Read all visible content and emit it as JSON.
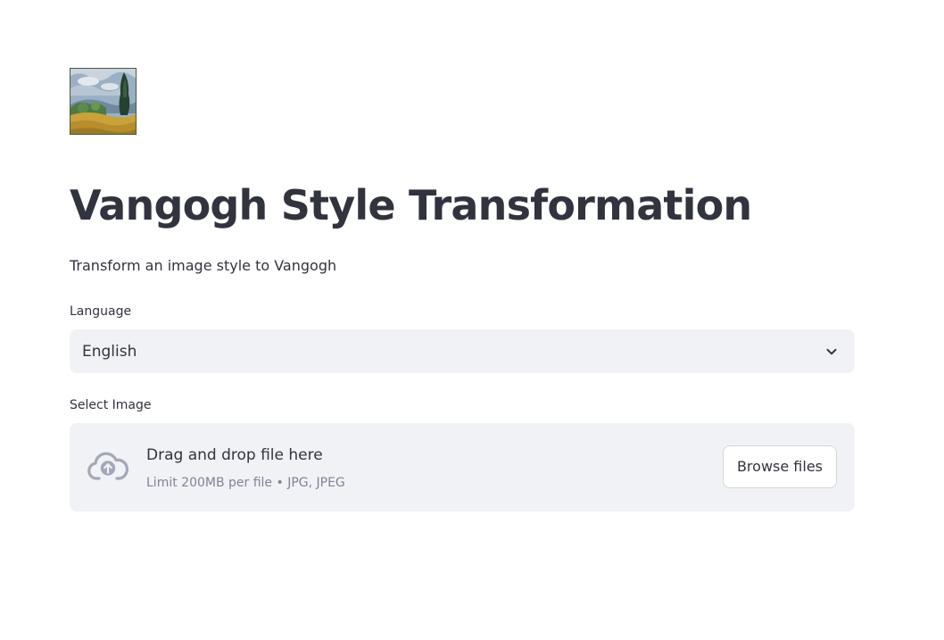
{
  "header": {
    "title": "Vangogh Style Transformation",
    "subtitle": "Transform an image style to Vangogh",
    "logo_icon": "wheatfield-painting-icon"
  },
  "language_select": {
    "label": "Language",
    "selected": "English",
    "icon": "chevron-down-icon"
  },
  "file_uploader": {
    "label": "Select Image",
    "drop_text": "Drag and drop file here",
    "limit_text": "Limit 200MB per file • JPG, JPEG",
    "browse_label": "Browse files",
    "icon": "cloud-upload-icon"
  },
  "colors": {
    "text": "#31333f",
    "muted": "#808495",
    "input_bg": "#f0f2f6",
    "icon": "#a3a8b8"
  }
}
